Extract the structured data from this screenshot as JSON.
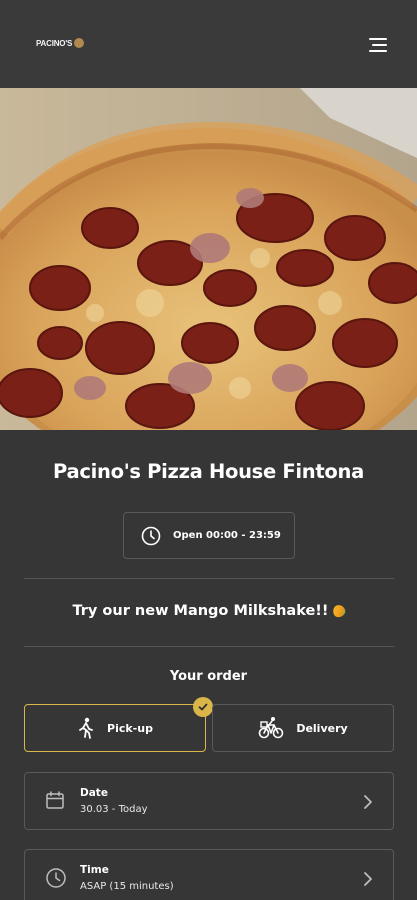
{
  "header": {
    "logo_text": "PACINO'S",
    "menu_icon": "hamburger-menu-icon"
  },
  "hero": {
    "image": "pepperoni-pizza-photo"
  },
  "restaurant": {
    "name": "Pacino's Pizza House Fintona",
    "hours": "Open 00:00 - 23:59"
  },
  "promo": {
    "text": "Try our new Mango Milkshake!!"
  },
  "order": {
    "heading": "Your order",
    "options": [
      {
        "label": "Pick-up",
        "icon": "walking-person-icon",
        "selected": true
      },
      {
        "label": "Delivery",
        "icon": "bicycle-courier-icon",
        "selected": false
      }
    ],
    "date": {
      "label": "Date",
      "value": "30.03 - Today",
      "icon": "calendar-icon"
    },
    "time": {
      "label": "Time",
      "value": "ASAP (15 minutes)",
      "icon": "clock-icon"
    }
  },
  "colors": {
    "background": "#363636",
    "header": "#3a3a3a",
    "accent": "#d9b54a",
    "border": "#5a5a5a"
  }
}
